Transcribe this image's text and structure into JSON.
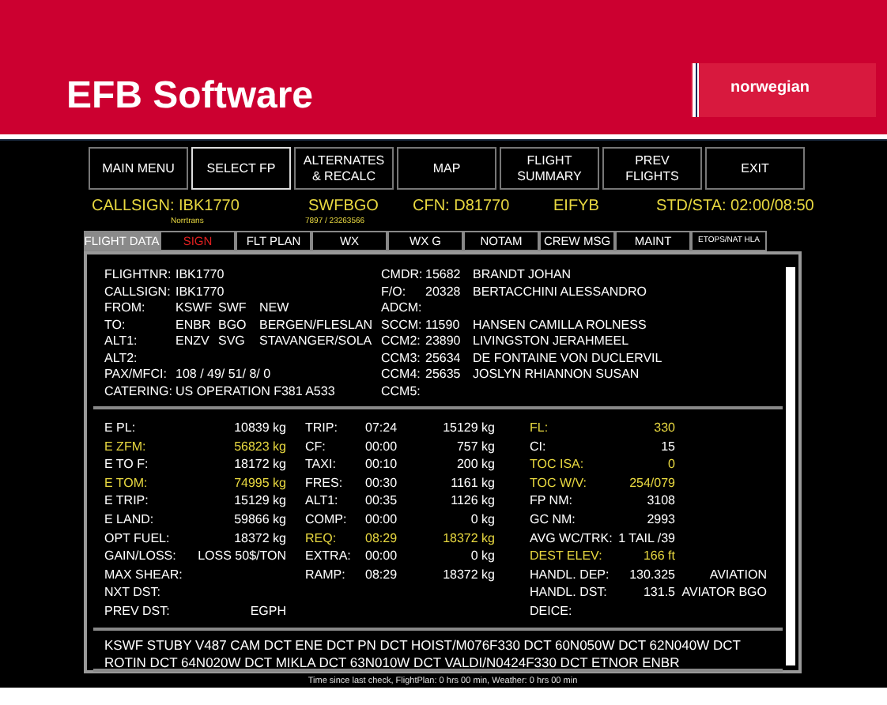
{
  "slide_title": "EFB Software",
  "logo": "norwegian",
  "menu_buttons": [
    {
      "label": "MAIN MENU",
      "selected": false
    },
    {
      "label": "SELECT FP",
      "selected": true
    },
    {
      "label": "ALTERNATES & RECALC",
      "selected": false
    },
    {
      "label": "MAP",
      "selected": false
    },
    {
      "label": "FLIGHT SUMMARY",
      "selected": false
    },
    {
      "label": "PREV FLIGHTS",
      "selected": false
    },
    {
      "label": "EXIT",
      "selected": false
    }
  ],
  "header": {
    "callsign": "CALLSIGN: IBK1770",
    "callsign_note": "Norrtrans",
    "route": "SWFBGO",
    "route_note": "7897 / 23263566",
    "cfn": "CFN: D81770",
    "registration": "EIFYB",
    "std_sta": "STD/STA: 02:00/08:50"
  },
  "tabs": [
    {
      "label": "FLIGHT DATA",
      "selected": true,
      "alert": false
    },
    {
      "label": "SIGN",
      "selected": false,
      "alert": true
    },
    {
      "label": "FLT PLAN",
      "selected": false,
      "alert": false
    },
    {
      "label": "WX",
      "selected": false,
      "alert": false
    },
    {
      "label": "WX G",
      "selected": false,
      "alert": false
    },
    {
      "label": "NOTAM",
      "selected": false,
      "alert": false
    },
    {
      "label": "CREW MSG",
      "selected": false,
      "alert": false
    },
    {
      "label": "MAINT",
      "selected": false,
      "alert": false
    },
    {
      "label": "ETOPS/NAT HLA",
      "selected": false,
      "alert": false
    }
  ],
  "flight_info": [
    {
      "label": "FLIGHTNR:",
      "values": [
        "IBK1770"
      ]
    },
    {
      "label": "CALLSIGN:",
      "values": [
        "IBK1770"
      ]
    },
    {
      "label": "FROM:",
      "values": [
        "KSWF",
        "SWF",
        "NEW"
      ]
    },
    {
      "label": "TO:",
      "values": [
        "ENBR",
        "BGO",
        "BERGEN/FLESLAN"
      ]
    },
    {
      "label": "ALT1:",
      "values": [
        "ENZV",
        "SVG",
        "STAVANGER/SOLA"
      ]
    },
    {
      "label": "ALT2:"
    },
    {
      "label": "PAX/MFCI:",
      "values": [
        "108 / 49/ 51/  8/  0"
      ]
    },
    {
      "label": "CATERING:",
      "values": [
        "US OPERATION F381 A533"
      ]
    }
  ],
  "crew": [
    {
      "label": "CMDR:",
      "number": "15682",
      "name": "BRANDT JOHAN"
    },
    {
      "label": "F/O:",
      "number": "20328",
      "name": "BERTACCHINI ALESSANDRO"
    },
    {
      "label": "ADCM:"
    },
    {
      "label": "SCCM:",
      "number": "11590",
      "name": "HANSEN CAMILLA ROLNESS"
    },
    {
      "label": "CCM2:",
      "number": "23890",
      "name": "LIVINGSTON JERAHMEEL"
    },
    {
      "label": "CCM3:",
      "number": "25634",
      "name": "DE FONTAINE VON DUCLERVIL"
    },
    {
      "label": "CCM4:",
      "number": "25635",
      "name": "JOSLYN RHIANNON SUSAN"
    },
    {
      "label": "CCM5:"
    }
  ],
  "weights": [
    {
      "label": "E PL:",
      "value": "10839 kg",
      "highlight": false
    },
    {
      "label": "E ZFM:",
      "value": "56823 kg",
      "highlight": true
    },
    {
      "label": "E TO F:",
      "value": "18172 kg",
      "highlight": false
    },
    {
      "label": "E TOM:",
      "value": "74995 kg",
      "highlight": true
    },
    {
      "label": "E TRIP:",
      "value": "15129 kg",
      "highlight": false
    },
    {
      "label": "E LAND:",
      "value": "59866 kg",
      "highlight": false
    },
    {
      "label": "OPT FUEL:",
      "value": "18372 kg",
      "highlight": false
    },
    {
      "label": "GAIN/LOSS:",
      "value": "LOSS  50$/TON",
      "highlight": false
    },
    {
      "label": "MAX SHEAR:",
      "highlight": false
    },
    {
      "label": "NXT DST:",
      "highlight": false
    },
    {
      "label": "PREV DST:",
      "value": "EGPH",
      "highlight": false
    }
  ],
  "fuel": [
    {
      "label": "TRIP:",
      "time": "07:24",
      "amount": "15129 kg",
      "highlight": false
    },
    {
      "label": "CF:",
      "time": "00:00",
      "amount": "757 kg",
      "highlight": false
    },
    {
      "label": "TAXI:",
      "time": "00:10",
      "amount": "200 kg",
      "highlight": false
    },
    {
      "label": "FRES:",
      "time": "00:30",
      "amount": "1161 kg",
      "highlight": false
    },
    {
      "label": "ALT1:",
      "time": "00:35",
      "amount": "1126 kg",
      "highlight": false
    },
    {
      "label": "COMP:",
      "time": "00:00",
      "amount": "0 kg",
      "highlight": false
    },
    {
      "label": "REQ:",
      "time": "08:29",
      "amount": "18372 kg",
      "highlight": true
    },
    {
      "label": "EXTRA:",
      "time": "00:00",
      "amount": "0 kg",
      "highlight": false
    },
    {
      "label": "RAMP:",
      "time": "08:29",
      "amount": "18372 kg",
      "highlight": false
    }
  ],
  "flight_params": [
    {
      "label": "FL:",
      "value": "330",
      "highlight": true
    },
    {
      "label": "CI:",
      "value": "15",
      "highlight": false
    },
    {
      "label": "TOC ISA:",
      "value": "0",
      "highlight": true
    },
    {
      "label": "TOC W/V:",
      "value": "254/079",
      "highlight": true
    },
    {
      "label": "FP NM:",
      "value": "3108",
      "highlight": false
    },
    {
      "label": "GC NM:",
      "value": "2993",
      "highlight": false
    },
    {
      "label": "AVG WC/TRK:",
      "value": "1 TAIL /39",
      "highlight": false
    },
    {
      "label": "DEST ELEV:",
      "value": "166 ft",
      "highlight": true
    },
    {
      "label": "HANDL. DEP:",
      "value": "130.325",
      "extra": "AVIATION",
      "highlight": false
    },
    {
      "label": "HANDL. DST:",
      "value": "131.5",
      "extra": "AVIATOR BGO",
      "highlight": false
    },
    {
      "label": "DEICE:",
      "highlight": false
    }
  ],
  "route": "KSWF STUBY V487 CAM DCT ENE DCT PN DCT HOIST/M076F330 DCT 60N050W DCT 62N040W DCT ROTIN DCT 64N020W DCT MIKLA DCT 63N010W DCT VALDI/N0424F330 DCT ETNOR ENBR",
  "status_bar": {
    "center": "Time since last check, FlightPlan: 0 hrs 00 min, Weather: 0 hrs 00 min"
  }
}
